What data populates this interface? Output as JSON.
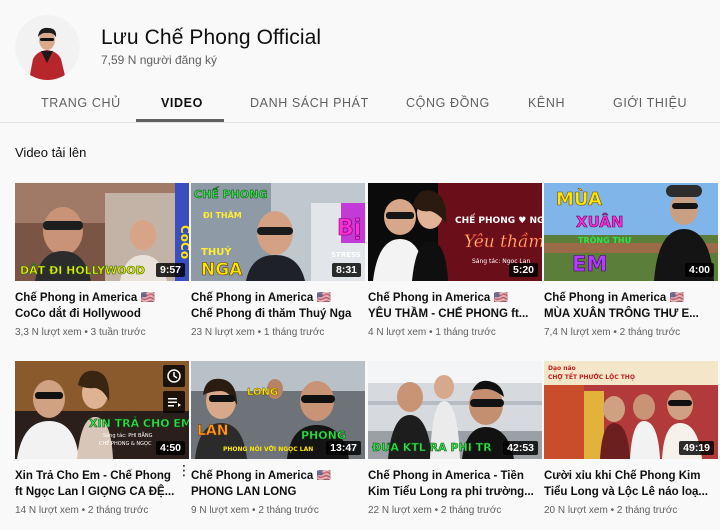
{
  "channel": {
    "name": "Lưu Chế Phong Official",
    "subscribers": "7,59 N người đăng ký"
  },
  "tabs": [
    {
      "label": "TRANG CHỦ"
    },
    {
      "label": "VIDEO"
    },
    {
      "label": "DANH SÁCH PHÁT"
    },
    {
      "label": "CỘNG ĐỒNG"
    },
    {
      "label": "KÊNH"
    },
    {
      "label": "GIỚI THIỆU"
    }
  ],
  "active_tab": "VIDEO",
  "section_title": "Video tải lên",
  "videos": [
    {
      "line1": "Chế Phong in America 🇺🇸",
      "line2": "CoCo dắt đi Hollywood",
      "views": "3,3 N lượt xem",
      "age": "3 tuần trước",
      "duration": "9:57",
      "thumb_text": "DẮT ĐI HOLLYWOOD",
      "thumb_text2": "CoCo"
    },
    {
      "line1": "Chế Phong in America 🇺🇸",
      "line2": "Chế Phong đi thăm Thuý Nga",
      "views": "23 N lượt xem",
      "age": "1 tháng trước",
      "duration": "8:31",
      "thumb_text": "CHẾ PHONG",
      "thumb_text2": "ĐI THĂM",
      "thumb_text3": "THUÝ",
      "thumb_text4": "NGA",
      "thumb_text5": "Bị",
      "thumb_text6": "STRESS"
    },
    {
      "line1": "Chế Phong in America 🇺🇸",
      "line2": "YÊU THẦM - CHẾ PHONG ft...",
      "views": "4 N lượt xem",
      "age": "1 tháng trước",
      "duration": "5:20",
      "thumb_text": "CHẾ PHONG ♥ NGỌC LAN",
      "thumb_text2": "Yêu thầm",
      "thumb_text3": "Sáng tác: Ngọc Lan"
    },
    {
      "line1": "Chế Phong in America 🇺🇸",
      "line2": "MÙA XUÂN TRÔNG THƯ E...",
      "views": "7,4 N lượt xem",
      "age": "2 tháng trước",
      "duration": "4:00",
      "thumb_text": "MÙA",
      "thumb_text2": "XUÂN",
      "thumb_text3": "TRÔNG THƯ",
      "thumb_text4": "EM"
    },
    {
      "line1": "Xin Trả Cho Em - Chế Phong",
      "line2": "ft Ngọc Lan l GIỌNG CA ĐỆ...",
      "views": "14 N lượt xem",
      "age": "2 tháng trước",
      "duration": "4:50",
      "thumb_text": "XIN TRẢ CHO EM",
      "thumb_text2": "Sáng tác: PHI BẰNG",
      "thumb_text3": "CHẾ PHONG & NGỌC"
    },
    {
      "line1": "Chế Phong in America 🇺🇸",
      "line2": "PHONG LAN LONG",
      "views": "9 N lượt xem",
      "age": "2 tháng trước",
      "duration": "13:47",
      "thumb_text": "LONG",
      "thumb_text2": "LAN",
      "thumb_text3": "PHONG",
      "thumb_text4": "PHONG NÓI VỚI NGỌC LAN"
    },
    {
      "line1": "Chế Phong in America - Tiền",
      "line2": "Kim Tiểu Long ra phi trường...",
      "views": "22 N lượt xem",
      "age": "2 tháng trước",
      "duration": "42:53",
      "thumb_text": "ĐƯA KTL RA PHI TR"
    },
    {
      "line1": "Cười xỉu khi Chế Phong Kim",
      "line2": "Tiểu Long và Lộc Lê náo loạ...",
      "views": "20 N lượt xem",
      "age": "2 tháng trước",
      "duration": "49:19",
      "thumb_text": "CHỢ TẾT PHƯỚC LỘC THỌ",
      "thumb_text2": "Dạo náo"
    }
  ],
  "colors": {
    "background": "#f9f9f9",
    "text_primary": "#0f0f0f",
    "text_secondary": "#606060",
    "tab_underline": "#606060"
  },
  "icons": [
    "avatar",
    "flag-us-icon",
    "more-vert-icon",
    "clock-icon",
    "playlist-icon"
  ]
}
